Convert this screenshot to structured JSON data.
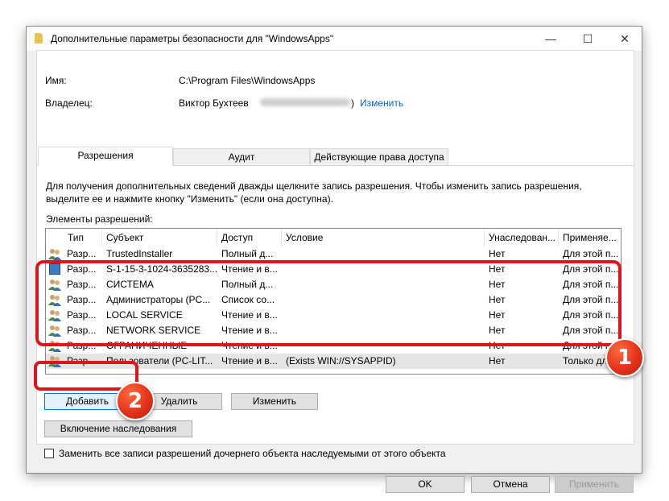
{
  "window": {
    "title": "Дополнительные параметры безопасности  для \"WindowsApps\"",
    "minimize": "—",
    "maximize": "☐",
    "close": "✕"
  },
  "info": {
    "name_label": "Имя:",
    "name_value": "C:\\Program Files\\WindowsApps",
    "owner_label": "Владелец:",
    "owner_value": "Виктор Бухтеев",
    "owner_paren": ")",
    "change_link": "Изменить"
  },
  "tabs": [
    "Разрешения",
    "Аудит",
    "Действующие права доступа"
  ],
  "description": "Для получения дополнительных сведений дважды щелкните запись разрешения. Чтобы изменить запись разрешения, выделите ее и нажмите кнопку \"Изменить\" (если она доступна).",
  "list_label": "Элементы разрешений:",
  "columns": [
    "Тип",
    "Субъект",
    "Доступ",
    "Условие",
    "Унаследован...",
    "Применяе..."
  ],
  "rows": [
    {
      "icon": "users-icon",
      "type": "Разр...",
      "subject": "TrustedInstaller",
      "access": "Полный д...",
      "condition": "",
      "inherited": "Нет",
      "applies": "Для этой п..."
    },
    {
      "icon": "sid-icon",
      "type": "Разр...",
      "subject": "S-1-15-3-1024-3635283...",
      "access": "Чтение и в...",
      "condition": "",
      "inherited": "Нет",
      "applies": "Для этой п..."
    },
    {
      "icon": "users-icon",
      "type": "Разр...",
      "subject": "СИСТЕМА",
      "access": "Полный д...",
      "condition": "",
      "inherited": "Нет",
      "applies": "Для этой п..."
    },
    {
      "icon": "users-icon",
      "type": "Разр...",
      "subject": "Администраторы (PC...",
      "access": "Список со...",
      "condition": "",
      "inherited": "Нет",
      "applies": "Для этой п..."
    },
    {
      "icon": "users-icon",
      "type": "Разр...",
      "subject": "LOCAL SERVICE",
      "access": "Чтение и в...",
      "condition": "",
      "inherited": "Нет",
      "applies": "Для этой п..."
    },
    {
      "icon": "users-icon",
      "type": "Разр...",
      "subject": "NETWORK SERVICE",
      "access": "Чтение и в...",
      "condition": "",
      "inherited": "Нет",
      "applies": "Для этой п..."
    },
    {
      "icon": "users-icon",
      "type": "Разр...",
      "subject": "ОГРАНИЧЕННЫЕ",
      "access": "Чтение и в...",
      "condition": "",
      "inherited": "Нет",
      "applies": "Для этой п..."
    },
    {
      "icon": "users-icon",
      "type": "Разр...",
      "subject": "Пользователи (PC-LIT...",
      "access": "Чтение и в...",
      "condition": "(Exists WIN://SYSAPPID)",
      "inherited": "Нет",
      "applies": "Только дл..."
    }
  ],
  "buttons": {
    "add": "Добавить",
    "remove": "Удалить",
    "edit": "Изменить",
    "enable_inheritance": "Включение наследования",
    "ok": "OK",
    "cancel": "Отмена",
    "apply": "Применить"
  },
  "replace_checkbox": "Заменить все записи разрешений дочернего объекта наследуемыми от этого объекта",
  "annotations": {
    "badge1": "1",
    "badge2": "2"
  },
  "colors": {
    "highlight": "#e0151b",
    "link": "#0066cc",
    "selection": "#e5e5e5"
  }
}
